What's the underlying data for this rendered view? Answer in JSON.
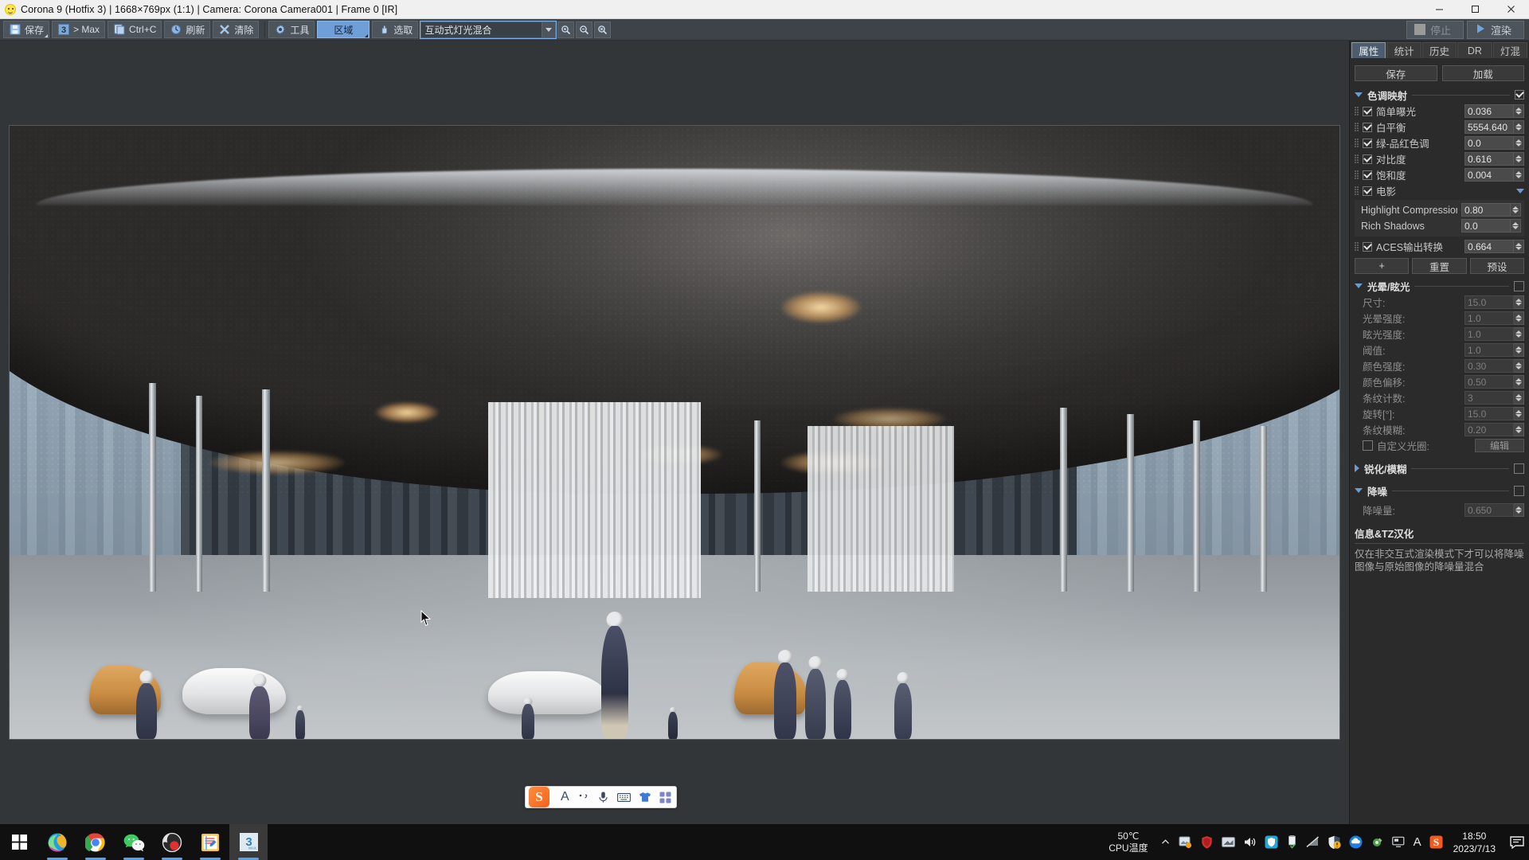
{
  "window": {
    "title": "Corona 9 (Hotfix 3) | 1668×769px (1:1) | Camera: Corona Camera001 | Frame 0 [IR]",
    "app_icon": "smiley-icon",
    "controls": {
      "minimize": "minimize-icon",
      "maximize": "maximize-icon",
      "close": "close-icon"
    }
  },
  "toolbar": {
    "buttons": [
      {
        "label": "保存",
        "icon": "save-icon",
        "state": "normal"
      },
      {
        "label": "> Max",
        "icon": "max-3-icon",
        "state": "normal"
      },
      {
        "label": "Ctrl+C",
        "icon": "copy-icon",
        "state": "normal"
      },
      {
        "label": "刷新",
        "icon": "refresh-icon",
        "state": "normal"
      },
      {
        "label": "清除",
        "icon": "close-x-icon",
        "state": "normal"
      },
      {
        "label": "工具",
        "icon": "gear-icon",
        "state": "normal"
      },
      {
        "label": "区域",
        "icon": "",
        "state": "active"
      },
      {
        "label": "选取",
        "icon": "hand-pointer-icon",
        "state": "normal"
      }
    ],
    "render_mode": {
      "value": "互动式灯光混合",
      "placeholder": "互动式灯光混合"
    },
    "zoom_buttons": [
      {
        "name": "zoom-in-button",
        "icon": "magnifier-plus-icon"
      },
      {
        "name": "zoom-out-button",
        "icon": "magnifier-minus-icon"
      },
      {
        "name": "zoom-reset-button",
        "icon": "magnifier-fit-icon"
      }
    ],
    "stop_label": "停止",
    "render_label": "渲染"
  },
  "panel": {
    "tabs": [
      {
        "label": "属性",
        "active": true
      },
      {
        "label": "统计",
        "active": false
      },
      {
        "label": "历史",
        "active": false
      },
      {
        "label": "DR",
        "active": false
      },
      {
        "label": "灯混",
        "active": false
      }
    ],
    "save_label": "保存",
    "load_label": "加载",
    "tonemapping": {
      "title": "色调映射",
      "enabled": true,
      "rows": [
        {
          "label": "简单曝光",
          "value": "0.036",
          "checked": true,
          "disabled": false
        },
        {
          "label": "白平衡",
          "value": "5554.640",
          "checked": true,
          "disabled": false
        },
        {
          "label": "绿-品红色调",
          "value": "0.0",
          "checked": true,
          "disabled": false
        },
        {
          "label": "对比度",
          "value": "0.616",
          "checked": true,
          "disabled": false
        },
        {
          "label": "饱和度",
          "value": "0.004",
          "checked": true,
          "disabled": false
        }
      ],
      "film": {
        "label": "电影",
        "checked": true,
        "rows": [
          {
            "label": "Highlight Compression",
            "value": "0.80"
          },
          {
            "label": "Rich Shadows",
            "value": "0.0"
          }
        ]
      },
      "aces": {
        "label": "ACES输出转换",
        "value": "0.664",
        "checked": true
      },
      "actions": [
        {
          "label": "+",
          "name": "add-preset-button"
        },
        {
          "label": "重置",
          "name": "reset-button"
        },
        {
          "label": "预设",
          "name": "presets-button"
        }
      ]
    },
    "bloom": {
      "title": "光晕/眩光",
      "enabled": false,
      "rows": [
        {
          "label": "尺寸:",
          "value": "15.0"
        },
        {
          "label": "光晕强度:",
          "value": "1.0"
        },
        {
          "label": "眩光强度:",
          "value": "1.0"
        },
        {
          "label": "阈值:",
          "value": "1.0"
        },
        {
          "label": "颜色强度:",
          "value": "0.30"
        },
        {
          "label": "颜色偏移:",
          "value": "0.50"
        },
        {
          "label": "条纹计数:",
          "value": "3"
        },
        {
          "label": "旋转[°]:",
          "value": "15.0"
        },
        {
          "label": "条纹模糊:",
          "value": "0.20"
        }
      ],
      "custom_aperture": {
        "label": "自定义光圈:",
        "checked": false,
        "button": "编辑"
      }
    },
    "sharpen": {
      "title": "锐化/模糊",
      "enabled": false,
      "expanded": false
    },
    "denoise": {
      "title": "降噪",
      "enabled": false,
      "rows": [
        {
          "label": "降噪量:",
          "value": "0.650"
        }
      ]
    },
    "info": {
      "title": "信息&TZ汉化",
      "text": "仅在非交互式渲染模式下才可以将降噪图像与原始图像的降噪量混合"
    }
  },
  "ime": {
    "logo": "S",
    "items": [
      {
        "name": "input-mode-chinese",
        "glyph": "A"
      },
      {
        "name": "punctuation-icon",
        "glyph": "，"
      },
      {
        "name": "voice-input-icon",
        "glyph": "mic"
      },
      {
        "name": "soft-keyboard-icon",
        "glyph": "keyboard"
      },
      {
        "name": "skin-icon",
        "glyph": "shirt"
      },
      {
        "name": "toolbox-icon",
        "glyph": "grid"
      }
    ]
  },
  "taskbar": {
    "start": "windows-start-icon",
    "items": [
      {
        "name": "taskbar-item-edge",
        "label": "Microsoft Edge",
        "open": true
      },
      {
        "name": "taskbar-item-chrome",
        "label": "Google Chrome",
        "open": true
      },
      {
        "name": "taskbar-item-wechat",
        "label": "WeChat",
        "open": true
      },
      {
        "name": "taskbar-item-obs",
        "label": "OBS Studio",
        "open": true
      },
      {
        "name": "taskbar-item-notepad",
        "label": "Notepad",
        "open": true
      },
      {
        "name": "taskbar-item-3dsmax",
        "label": "3ds Max",
        "open": true,
        "active": true
      }
    ],
    "cpu_temp": "50℃",
    "cpu_label": "CPU温度",
    "tray_icons": [
      "show-hidden-icons-chevron",
      "screenshot-icon",
      "shield-red-icon",
      "graphics-icon",
      "volume-icon",
      "security-blue-icon",
      "usb-eject-icon",
      "network-disconnected-icon",
      "protection-warning-icon",
      "cloud-blue-icon",
      "driver-icon",
      "display-icon",
      "language-a-icon",
      "sogou-s-icon"
    ],
    "time": "18:50",
    "date": "2023/7/13",
    "notifications": "notification-icon"
  }
}
